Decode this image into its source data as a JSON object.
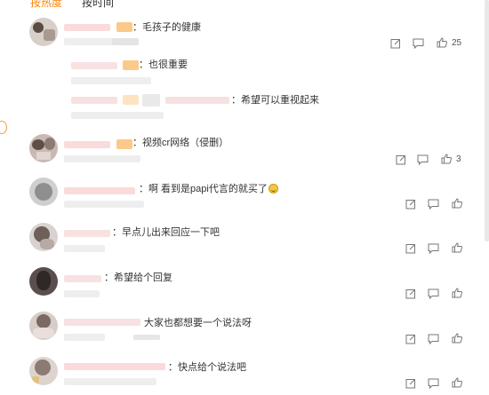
{
  "tabs": {
    "active": "按热度",
    "other": "按时间"
  },
  "comments": [
    {
      "text": "：毛孩子的健康",
      "likes": "25"
    },
    {
      "text": "：也很重要"
    },
    {
      "text": "：希望可以重视起来"
    },
    {
      "text": "：视频cr网络（侵删）",
      "likes": "3"
    },
    {
      "text": "：啊 看到是papi代言的就买了"
    },
    {
      "text": "：早点儿出来回应一下吧"
    },
    {
      "text": "：希望给个回复"
    },
    {
      "text": "大家也都想要一个说法呀"
    },
    {
      "text": "：快点给个说法吧"
    }
  ],
  "icons": {
    "share": "share-icon",
    "comment": "comment-icon",
    "like": "thumbs-up-icon",
    "emoji": "grinning-emoji-icon"
  },
  "colors": {
    "accent": "#ff8200",
    "text": "#333333",
    "icon": "#777777"
  }
}
